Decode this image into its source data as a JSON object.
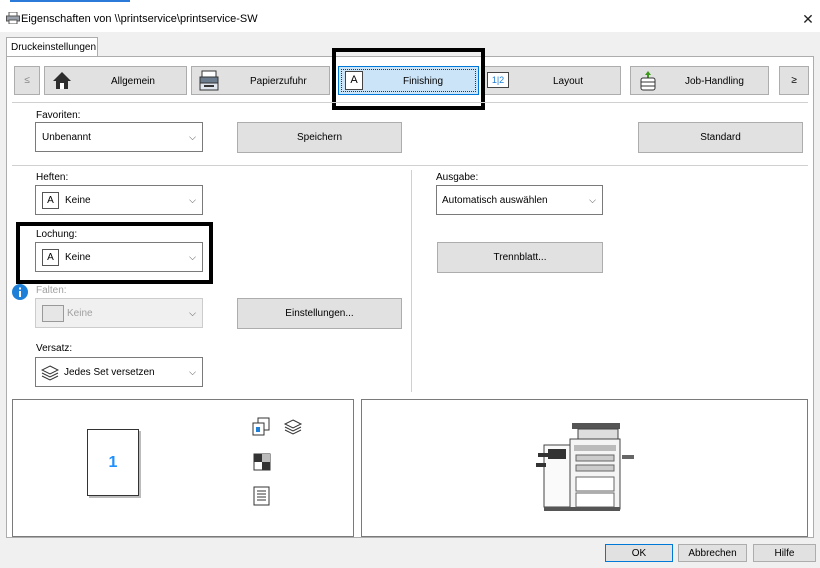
{
  "window": {
    "title": "Eigenschaften von \\\\printservice\\printservice-SW",
    "close_glyph": "✕"
  },
  "tab": {
    "label": "Druckeinstellungen"
  },
  "nav": {
    "prev": "≤",
    "next": "≥",
    "items": [
      {
        "label": "Allgemein",
        "icon": "home-icon",
        "selected": false
      },
      {
        "label": "Papierzufuhr",
        "icon": "paper-tray-icon",
        "selected": false
      },
      {
        "label": "Finishing",
        "icon": "finishing-icon",
        "selected": true,
        "glyph": "A"
      },
      {
        "label": "Layout",
        "icon": "layout-icon",
        "selected": false,
        "glyph": "1|2"
      },
      {
        "label": "Job-Handling",
        "icon": "job-handling-icon",
        "selected": false
      }
    ]
  },
  "favorites": {
    "label": "Favoriten:",
    "value": "Unbenannt",
    "save": "Speichern",
    "default": "Standard"
  },
  "stapling": {
    "label": "Heften:",
    "value": "Keine",
    "glyph": "A"
  },
  "punch": {
    "label": "Lochung:",
    "value": "Keine",
    "glyph": "A"
  },
  "fold": {
    "label": "Falten:",
    "value": "Keine",
    "settings": "Einstellungen..."
  },
  "offset": {
    "label": "Versatz:",
    "value": "Jedes Set versetzen"
  },
  "output": {
    "label": "Ausgabe:",
    "value": "Automatisch auswählen",
    "separator": "Trennblatt..."
  },
  "preview": {
    "page_number": "1"
  },
  "footer": {
    "ok": "OK",
    "cancel": "Abbrechen",
    "help": "Hilfe"
  },
  "colors": {
    "accent": "#0078d7",
    "selected_bg": "#cce4f7",
    "info": "#1e7fd8",
    "page_number": "#1e90ff"
  }
}
